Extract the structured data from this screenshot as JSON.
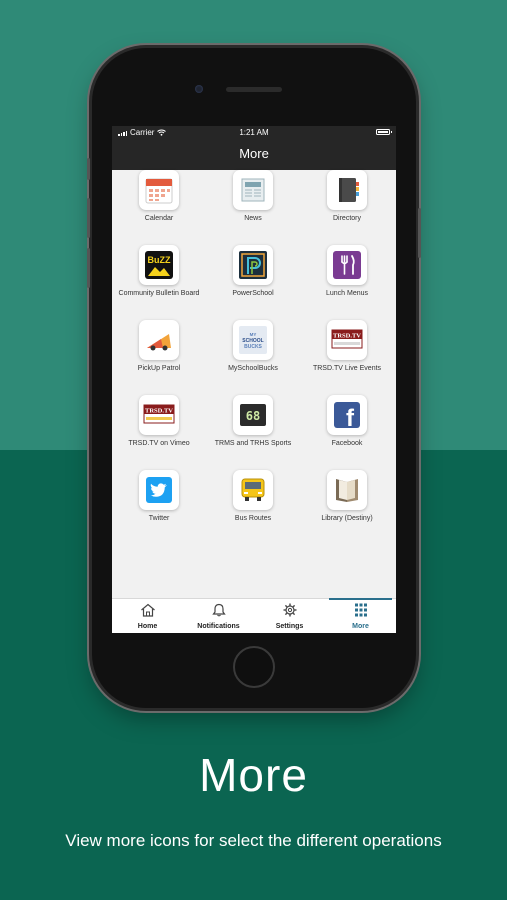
{
  "status": {
    "carrier": "Carrier",
    "time": "1:21 AM"
  },
  "nav": {
    "title": "More"
  },
  "tiles": [
    {
      "label": "Calendar",
      "icon": "calendar-icon"
    },
    {
      "label": "News",
      "icon": "newspaper-icon"
    },
    {
      "label": "Directory",
      "icon": "directory-book-icon"
    },
    {
      "label": "Community Bulletin Board",
      "icon": "buzz-bulletin-icon"
    },
    {
      "label": "PowerSchool",
      "icon": "powerschool-logo-icon"
    },
    {
      "label": "Lunch Menus",
      "icon": "fork-knife-icon"
    },
    {
      "label": "PickUp Patrol",
      "icon": "pickup-patrol-icon"
    },
    {
      "label": "MySchoolBucks",
      "icon": "myschoolbucks-icon"
    },
    {
      "label": "TRSD.TV Live Events",
      "icon": "trsd-tv-icon"
    },
    {
      "label": "TRSD.TV on Vimeo",
      "icon": "trsd-tv-vimeo-icon"
    },
    {
      "label": "TRMS and TRHS Sports",
      "icon": "scoreboard-icon"
    },
    {
      "label": "Facebook",
      "icon": "facebook-icon"
    },
    {
      "label": "Twitter",
      "icon": "twitter-bird-icon"
    },
    {
      "label": "Bus Routes",
      "icon": "school-bus-icon"
    },
    {
      "label": "Library (Destiny)",
      "icon": "open-book-icon"
    }
  ],
  "icon_text": {
    "buzz": "BuZZ",
    "trsd": "TRSD.TV",
    "score": "68",
    "msb_line1": "MY",
    "msb_line2": "SCHOOL",
    "msb_line3": "BUCKS",
    "facebook": "f"
  },
  "tabs": [
    {
      "label": "Home",
      "icon": "home-icon",
      "active": false
    },
    {
      "label": "Notifications",
      "icon": "bell-icon",
      "active": false
    },
    {
      "label": "Settings",
      "icon": "gear-icon",
      "active": false
    },
    {
      "label": "More",
      "icon": "grid-dots-icon",
      "active": true
    }
  ],
  "caption": {
    "title": "More",
    "subtitle": "View more icons for select the different operations"
  },
  "colors": {
    "bg_top": "#2f8a77",
    "bg_bottom": "#0b6551",
    "header": "#262626",
    "tab_active": "#2a6f8c"
  }
}
